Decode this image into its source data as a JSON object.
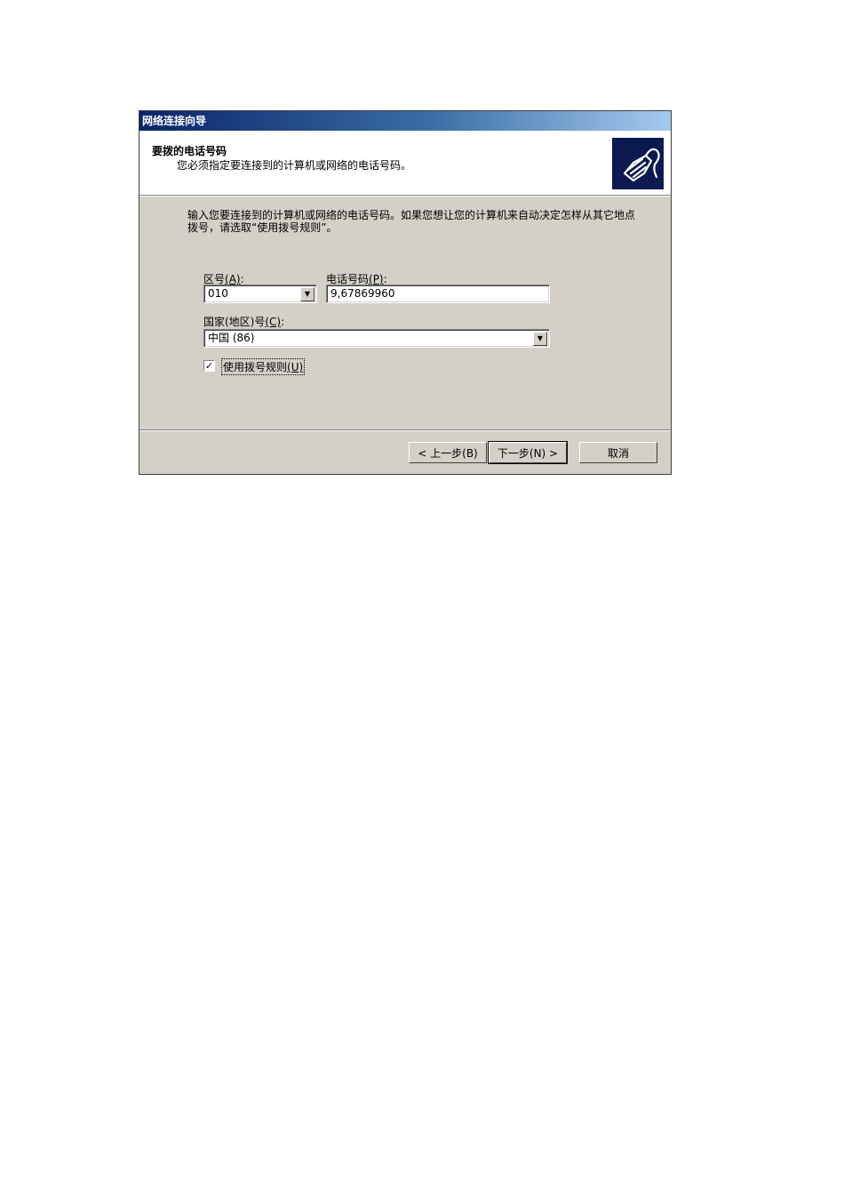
{
  "window": {
    "title": "网络连接向导"
  },
  "header": {
    "title": "要拨的电话号码",
    "subtitle": "您必须指定要连接到的计算机或网络的电话号码。",
    "icon": "phone-plug-icon"
  },
  "intro": "输入您要连接到的计算机或网络的电话号码。如果您想让您的计算机来自动决定怎样从其它地点拨号，请选取“使用拨号规则”。",
  "area_code": {
    "label": "区号",
    "accel": "(A)",
    "suffix": ":",
    "value": "010"
  },
  "phone_number": {
    "label": "电话号码",
    "accel": "(P)",
    "suffix": ":",
    "value": "9,67869960"
  },
  "country": {
    "label": "国家(地区)号",
    "accel": "(C)",
    "suffix": ":",
    "value": "中国  (86)"
  },
  "dialing_rules": {
    "label": "使用拨号规则",
    "accel": "(U)",
    "checked": true,
    "check_glyph": "✓"
  },
  "buttons": {
    "back": "< 上一步(B)",
    "next": "下一步(N) >",
    "cancel": "取消"
  },
  "colors": {
    "dialog_bg": "#d4d0c8",
    "titlebar_start": "#0a246a",
    "titlebar_end": "#a6caf0",
    "icon_bg": "#0c1a52"
  }
}
